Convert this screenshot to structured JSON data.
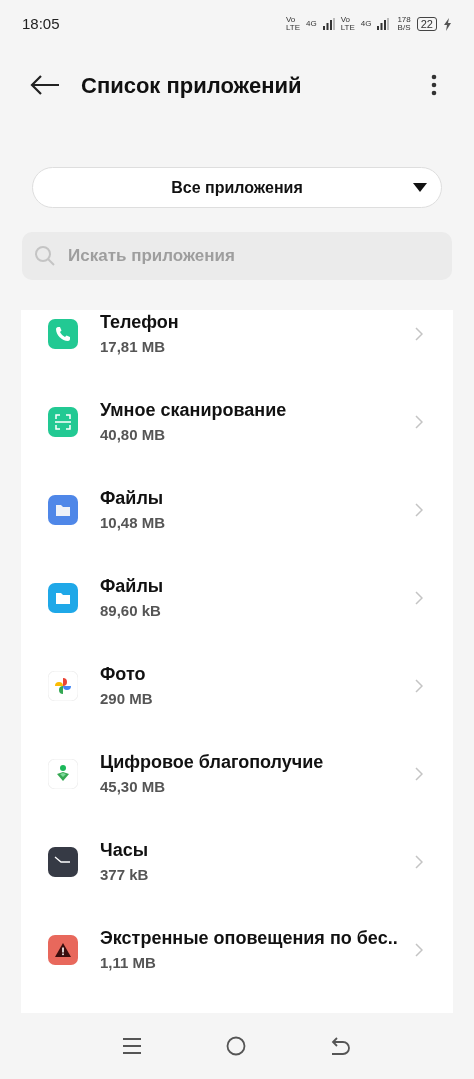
{
  "status_bar": {
    "time": "18:05",
    "sims": [
      {
        "vo": "Vo",
        "lte": "LTE",
        "net": "4G"
      },
      {
        "vo": "Vo",
        "lte": "LTE",
        "net": "4G"
      }
    ],
    "speed": "178",
    "speed_unit": "B/S",
    "battery": "22"
  },
  "header": {
    "title": "Список приложений"
  },
  "filter": {
    "value": "Все приложения"
  },
  "search": {
    "placeholder": "Искать приложения"
  },
  "apps": [
    {
      "name": "Телефон",
      "size": "17,81 MB"
    },
    {
      "name": "Умное сканирование",
      "size": "40,80 MB"
    },
    {
      "name": "Файлы",
      "size": "10,48 MB"
    },
    {
      "name": "Файлы",
      "size": "89,60 kB"
    },
    {
      "name": "Фото",
      "size": "290 MB"
    },
    {
      "name": "Цифровое благополучие",
      "size": "45,30 MB"
    },
    {
      "name": "Часы",
      "size": "377 kB"
    },
    {
      "name": "Экстренные оповещения по бес..",
      "size": "1,11 MB"
    }
  ]
}
